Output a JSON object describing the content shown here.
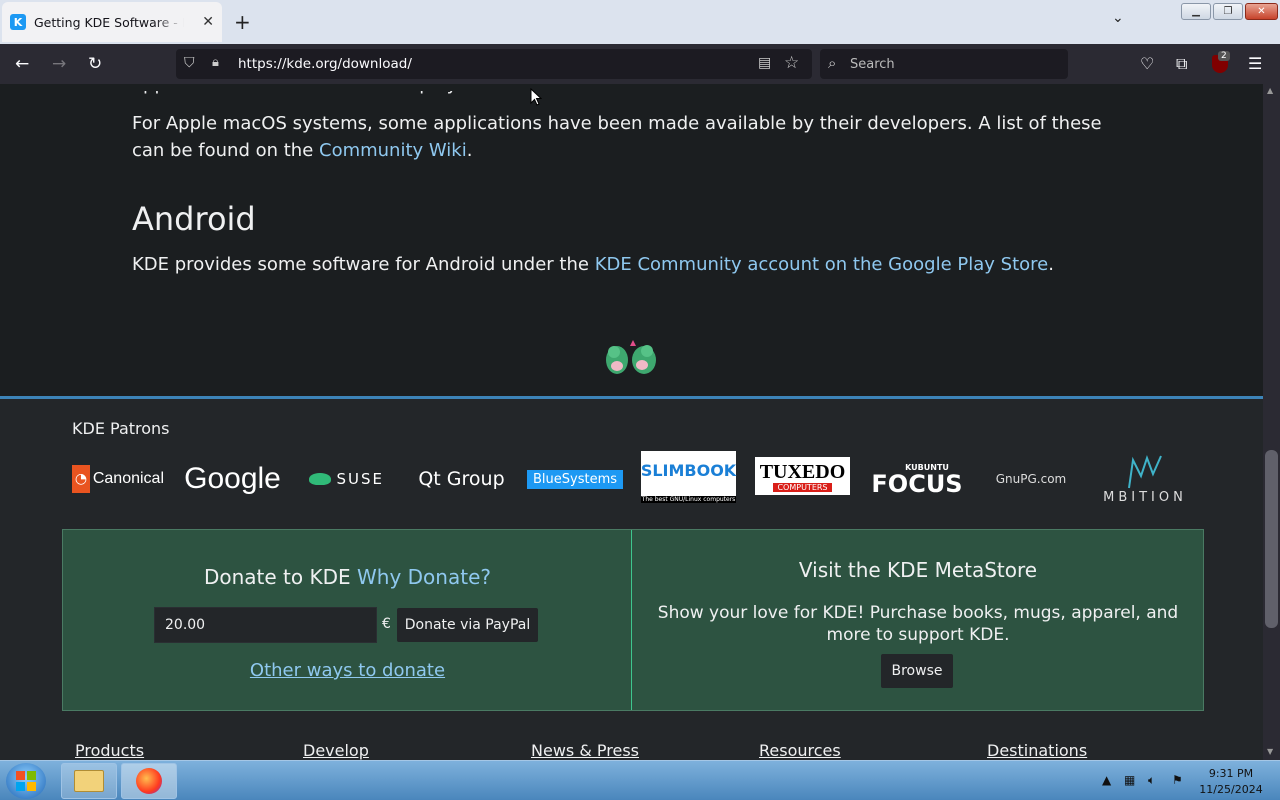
{
  "browser": {
    "tab_title": "Getting KDE Software - KDE Community",
    "favicon_text": "K",
    "url": "https://kde.org/download/",
    "search_placeholder": "Search",
    "extension_badge": "2"
  },
  "content": {
    "cut_line": "applications are available on ... play",
    "macos_text_1": "For Apple macOS systems, some applications have been made available by their developers. A list of these can be found on the ",
    "macos_link": "Community Wiki",
    "macos_text_2": ".",
    "android_heading": "Android",
    "android_text_1": "KDE provides some software for Android under the ",
    "android_link": "KDE Community account on the Google Play Store",
    "android_text_2": "."
  },
  "footer": {
    "patrons_title": "KDE Patrons",
    "sponsors": [
      "Canonical",
      "Google",
      "SUSE",
      "Qt Group",
      "BlueSystems",
      "SLIMBOOK",
      "TUXEDO",
      "FOCUS",
      "GnuPG.com",
      "MBITION"
    ],
    "sponsor_extra": {
      "slimbook_tagline": "The best GNU/Linux computers",
      "tuxedo_sub": "COMPUTERS",
      "focus_top": "KUBUNTU"
    },
    "donate": {
      "title": "Donate to KDE ",
      "why_link": "Why Donate?",
      "amount": "20.00",
      "currency": "€",
      "paypal_button": "Donate via PayPal",
      "other_ways": "Other ways to donate"
    },
    "store": {
      "title": "Visit the KDE MetaStore",
      "text": "Show your love for KDE! Purchase books, mugs, apparel, and more to support KDE.",
      "browse_button": "Browse"
    },
    "nav": [
      "Products",
      "Develop",
      "News & Press",
      "Resources",
      "Destinations"
    ]
  },
  "taskbar": {
    "time": "9:31 PM",
    "date": "11/25/2024"
  },
  "colors": {
    "link": "#8fc8ef",
    "page_bg": "#1b1e20",
    "footer_bg": "#232629",
    "donate_bg": "#2d5341"
  }
}
